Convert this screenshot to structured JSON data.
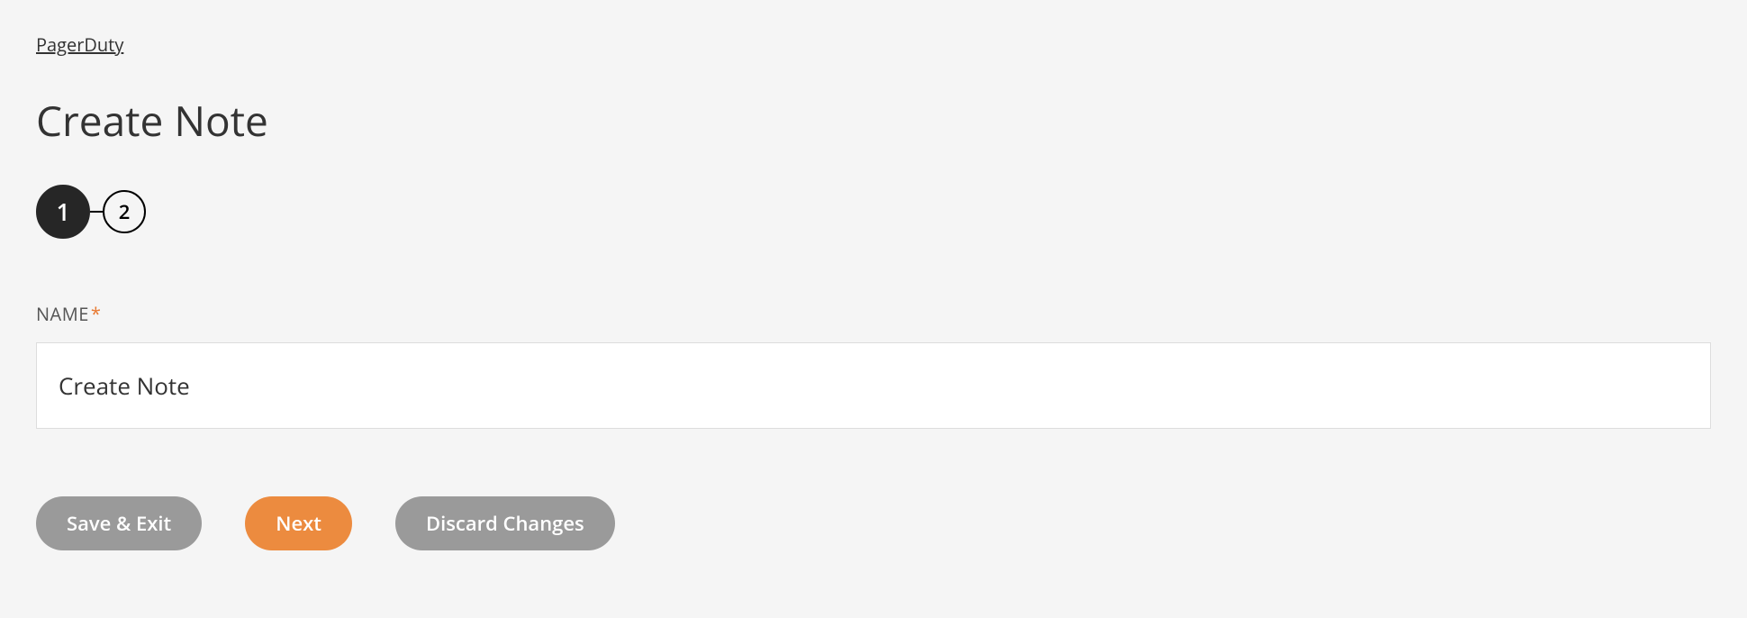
{
  "breadcrumb": {
    "parent": "PagerDuty"
  },
  "page": {
    "title": "Create Note"
  },
  "stepper": {
    "steps": [
      "1",
      "2"
    ],
    "current": 1
  },
  "form": {
    "name_label": "NAME",
    "required_mark": "*",
    "name_value": "Create Note"
  },
  "buttons": {
    "save_exit": "Save & Exit",
    "next": "Next",
    "discard": "Discard Changes"
  }
}
